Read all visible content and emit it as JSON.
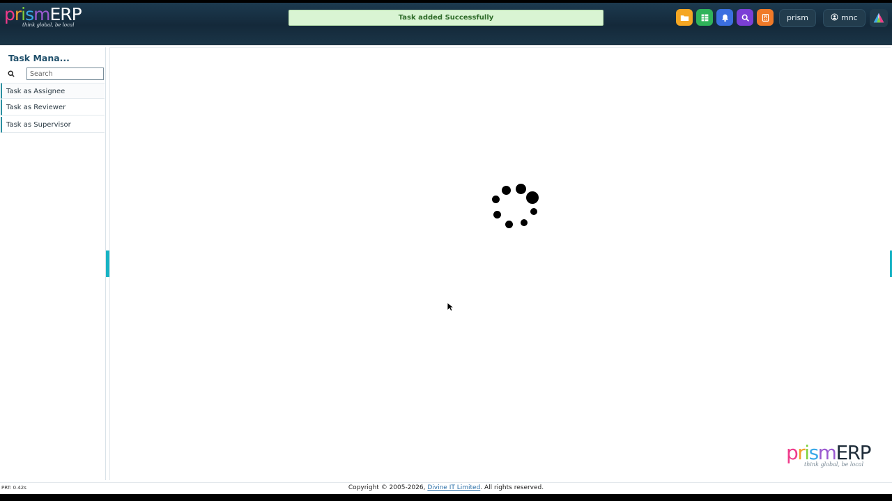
{
  "header": {
    "logo": {
      "prefix": "prism",
      "suffix": "ERP",
      "tagline": "think global, be local"
    },
    "toast": "Task added Successfully",
    "icons": [
      {
        "name": "folder-icon",
        "color": "#f5a623"
      },
      {
        "name": "spreadsheet-icon",
        "color": "#2fb35a"
      },
      {
        "name": "bell-icon",
        "color": "#3b6fe0"
      },
      {
        "name": "search-icon",
        "color": "#7b3fd6"
      },
      {
        "name": "calculator-icon",
        "color": "#f07a28"
      }
    ],
    "company_label": "prism",
    "user_label": "mnc"
  },
  "sidebar": {
    "title": "Task Mana...",
    "search": {
      "placeholder": "Search",
      "value": ""
    },
    "items": [
      {
        "label": "Task as Assignee"
      },
      {
        "label": "Task as Reviewer"
      },
      {
        "label": "Task as Supervisor"
      }
    ]
  },
  "brand_watermark": {
    "prefix": "prism",
    "suffix": "ERP",
    "tagline": "think global, be local"
  },
  "footer": {
    "prt": "PRT: 0.42s",
    "copyright_prefix": "Copyright © 2005-2026, ",
    "company_link": "Divine IT Limited",
    "copyright_suffix": ". All rights reserved."
  }
}
